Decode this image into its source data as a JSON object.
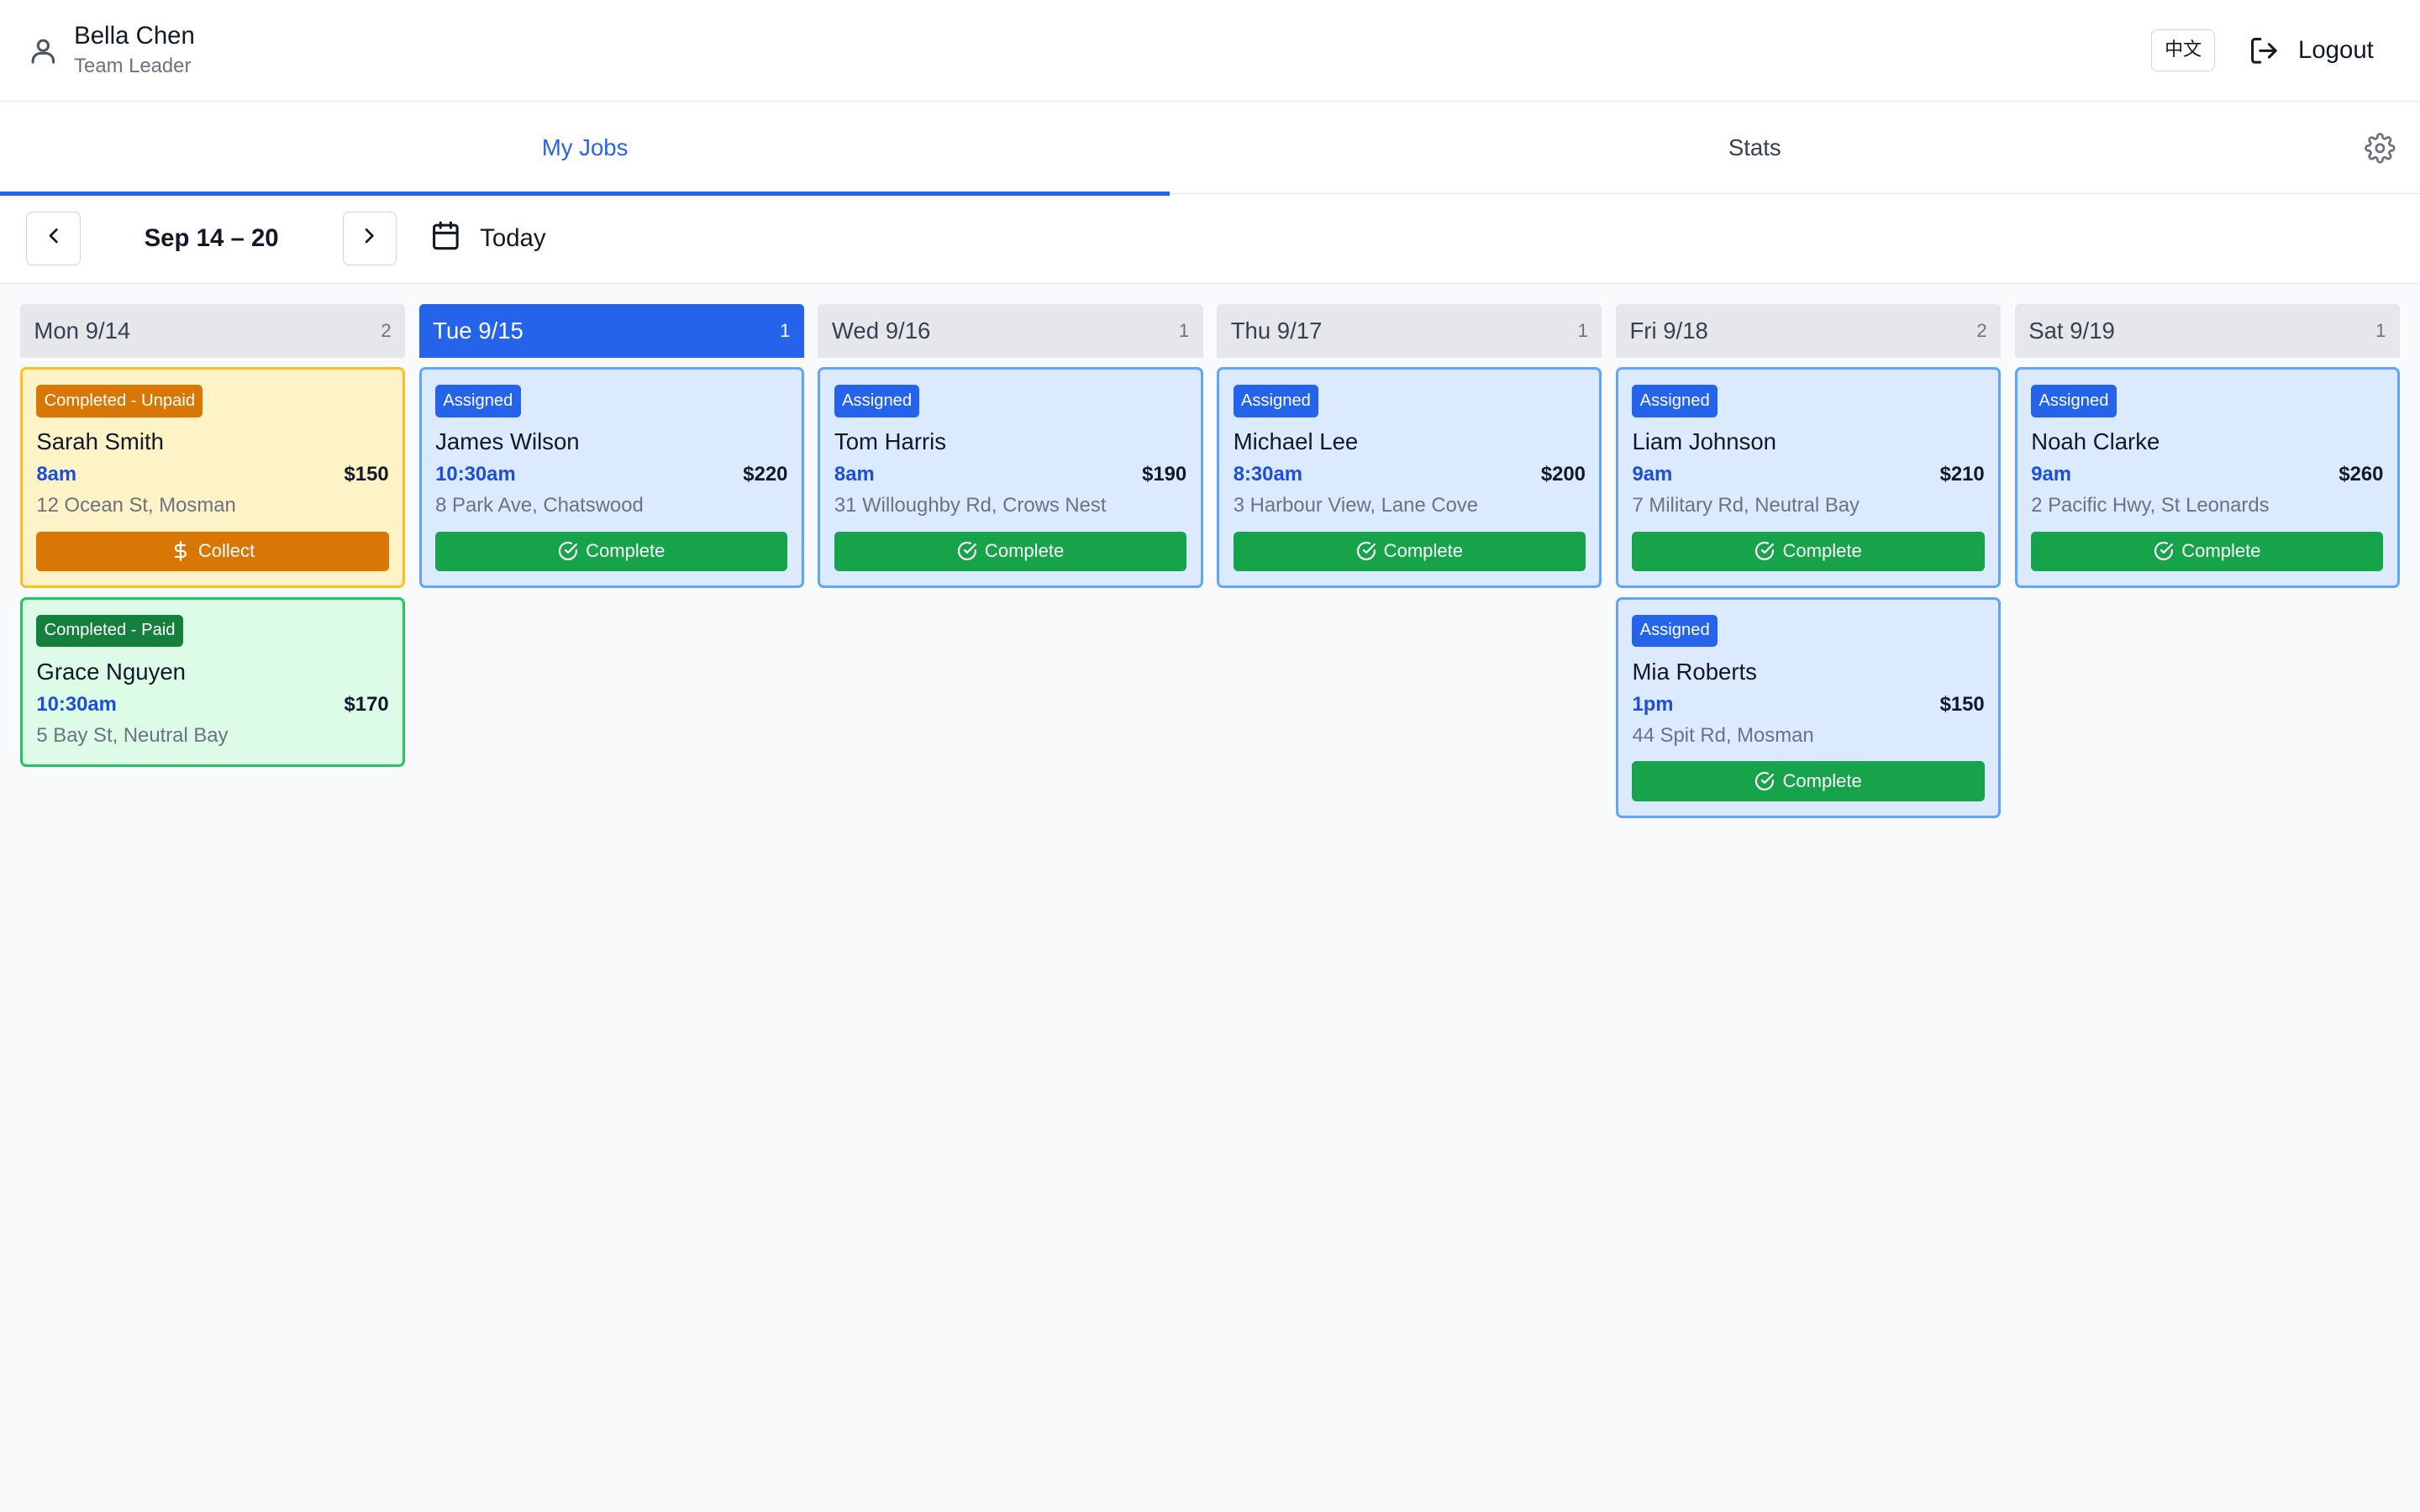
{
  "header": {
    "user_name": "Bella Chen",
    "user_role": "Team Leader",
    "lang_label": "中文",
    "logout_label": "Logout"
  },
  "tabs": [
    {
      "label": "My Jobs",
      "active": true
    },
    {
      "label": "Stats",
      "active": false
    }
  ],
  "weeknav": {
    "range": "Sep 14 – 20",
    "today_label": "Today"
  },
  "colors": {
    "accent": "#2563eb",
    "assigned_card": "#dbeafe",
    "unpaid_card": "#fef3c7",
    "paid_card": "#dcfce7",
    "complete_button": "#16a34a",
    "collect_button": "#d97706"
  },
  "days": [
    {
      "label": "Mon 9/14",
      "count": "2",
      "today": false,
      "jobs": [
        {
          "status": "Completed - Unpaid",
          "kind": "unpaid",
          "customer": "Sarah Smith",
          "time": "8am",
          "price": "$150",
          "address": "12 Ocean St, Mosman",
          "action": "Collect",
          "action_icon": "dollar-icon"
        },
        {
          "status": "Completed - Paid",
          "kind": "paid",
          "customer": "Grace Nguyen",
          "time": "10:30am",
          "price": "$170",
          "address": "5 Bay St, Neutral Bay",
          "action": "",
          "action_icon": ""
        }
      ]
    },
    {
      "label": "Tue 9/15",
      "count": "1",
      "today": true,
      "jobs": [
        {
          "status": "Assigned",
          "kind": "assigned",
          "customer": "James Wilson",
          "time": "10:30am",
          "price": "$220",
          "address": "8 Park Ave, Chatswood",
          "action": "Complete",
          "action_icon": "check-circle-icon"
        }
      ]
    },
    {
      "label": "Wed 9/16",
      "count": "1",
      "today": false,
      "jobs": [
        {
          "status": "Assigned",
          "kind": "assigned",
          "customer": "Tom Harris",
          "time": "8am",
          "price": "$190",
          "address": "31 Willoughby Rd, Crows Nest",
          "action": "Complete",
          "action_icon": "check-circle-icon"
        }
      ]
    },
    {
      "label": "Thu 9/17",
      "count": "1",
      "today": false,
      "jobs": [
        {
          "status": "Assigned",
          "kind": "assigned",
          "customer": "Michael Lee",
          "time": "8:30am",
          "price": "$200",
          "address": "3 Harbour View, Lane Cove",
          "action": "Complete",
          "action_icon": "check-circle-icon"
        }
      ]
    },
    {
      "label": "Fri 9/18",
      "count": "2",
      "today": false,
      "jobs": [
        {
          "status": "Assigned",
          "kind": "assigned",
          "customer": "Liam Johnson",
          "time": "9am",
          "price": "$210",
          "address": "7 Military Rd, Neutral Bay",
          "action": "Complete",
          "action_icon": "check-circle-icon"
        },
        {
          "status": "Assigned",
          "kind": "assigned",
          "customer": "Mia Roberts",
          "time": "1pm",
          "price": "$150",
          "address": "44 Spit Rd, Mosman",
          "action": "Complete",
          "action_icon": "check-circle-icon"
        }
      ]
    },
    {
      "label": "Sat 9/19",
      "count": "1",
      "today": false,
      "jobs": [
        {
          "status": "Assigned",
          "kind": "assigned",
          "customer": "Noah Clarke",
          "time": "9am",
          "price": "$260",
          "address": "2 Pacific Hwy, St Leonards",
          "action": "Complete",
          "action_icon": "check-circle-icon"
        }
      ]
    }
  ]
}
